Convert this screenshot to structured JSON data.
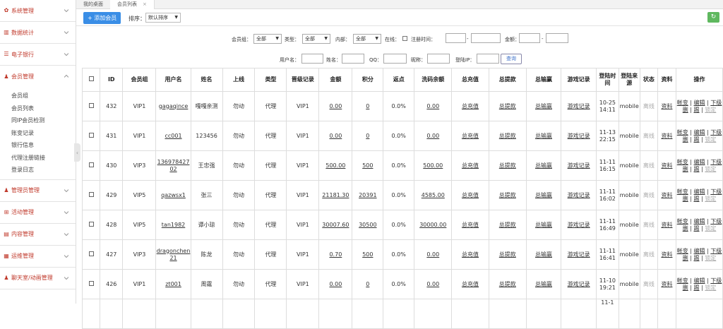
{
  "sidebar": {
    "groups": [
      {
        "label": "系统管理",
        "icon": "gear-icon"
      },
      {
        "label": "数据统计",
        "icon": "chart-icon"
      },
      {
        "label": "电子银行",
        "icon": "list-icon"
      },
      {
        "label": "会员管理",
        "icon": "user-icon"
      },
      {
        "label": "管理员管理",
        "icon": "admin-icon"
      },
      {
        "label": "活动管理",
        "icon": "gift-icon"
      },
      {
        "label": "内容管理",
        "icon": "content-icon"
      },
      {
        "label": "运维管理",
        "icon": "ops-icon"
      },
      {
        "label": "聊天室/动画管理",
        "icon": "chat-icon"
      }
    ],
    "member_sub": [
      "会员组",
      "会员列表",
      "同IP会员检测",
      "账变记录",
      "银行信息",
      "代理注册链接",
      "登录日志"
    ]
  },
  "tabs": [
    {
      "label": "我的桌面"
    },
    {
      "label": "会员列表",
      "close": "×"
    }
  ],
  "toolbar": {
    "add_label": "添加会员",
    "sort_label": "排序：",
    "sort_value": "默认排序"
  },
  "filters": {
    "group_label": "会员组：",
    "group_value": "全部",
    "type_label": "类型：",
    "type_value": "全部",
    "inner_label": "内部：",
    "inner_value": "全部",
    "online_label": "在线：",
    "reg_label": "注册时间：",
    "dash": "-",
    "amount_label": "金额：",
    "username_label": "用户名：",
    "name_label": "姓名：",
    "qq_label": "QQ：",
    "nick_label": "昵称：",
    "ip_label": "登陆IP：",
    "query_label": "查询"
  },
  "table": {
    "headers": [
      "ID",
      "会员组",
      "用户名",
      "姓名",
      "上线",
      "类型",
      "晋级记录",
      "金额",
      "积分",
      "返点",
      "洗码余额",
      "总充值",
      "总提款",
      "总输赢",
      "游戏记录",
      "登陆时间",
      "登陆来源",
      "状态",
      "资料",
      "操作"
    ],
    "rows": [
      {
        "id": "432",
        "group": "VIP1",
        "user": "gagaqince",
        "name": "嘎嘎亲测",
        "parent": "勿动",
        "type": "代理",
        "level": "VIP1",
        "amount": "0.00",
        "points": "0",
        "rebate": "0.0%",
        "wash": "0.00",
        "time": "10-25 14:11",
        "source": "mobile"
      },
      {
        "id": "431",
        "group": "VIP1",
        "user": "cc001",
        "name": "123456",
        "parent": "勿动",
        "type": "代理",
        "level": "VIP1",
        "amount": "0.00",
        "points": "0",
        "rebate": "0.0%",
        "wash": "0.00",
        "time": "11-13 22:15",
        "source": "mobile"
      },
      {
        "id": "430",
        "group": "VIP3",
        "user": "13697842702",
        "name": "王忠强",
        "parent": "勿动",
        "type": "代理",
        "level": "VIP1",
        "amount": "500.00",
        "points": "500",
        "rebate": "0.0%",
        "wash": "500.00",
        "time": "11-11 16:15",
        "source": "mobile"
      },
      {
        "id": "429",
        "group": "VIP5",
        "user": "qazwsx1",
        "name": "张三",
        "parent": "勿动",
        "type": "代理",
        "level": "VIP1",
        "amount": "21181.30",
        "points": "20391",
        "rebate": "0.0%",
        "wash": "4585.00",
        "time": "11-11 16:02",
        "source": "mobile"
      },
      {
        "id": "428",
        "group": "VIP5",
        "user": "tan1982",
        "name": "谭小琼",
        "parent": "勿动",
        "type": "代理",
        "level": "VIP1",
        "amount": "30007.60",
        "points": "30500",
        "rebate": "0.0%",
        "wash": "30000.00",
        "time": "11-11 16:49",
        "source": "mobile"
      },
      {
        "id": "427",
        "group": "VIP3",
        "user": "dragonchen21",
        "name": "陈龙",
        "parent": "勿动",
        "type": "代理",
        "level": "VIP1",
        "amount": "0.70",
        "points": "500",
        "rebate": "0.0%",
        "wash": "0.00",
        "time": "11-11 16:41",
        "source": "mobile"
      },
      {
        "id": "426",
        "group": "VIP1",
        "user": "zt001",
        "name": "周霆",
        "parent": "勿动",
        "type": "代理",
        "level": "VIP1",
        "amount": "0.00",
        "points": "0",
        "rebate": "0.0%",
        "wash": "0.00",
        "time": "11-10 19:21",
        "source": "mobile"
      }
    ],
    "partial_row_time": "11-1",
    "links": {
      "recharge": "总充值",
      "withdraw": "总提款",
      "winloss": "总输赢",
      "games": "游戏记录"
    },
    "status": "离线",
    "profile": "资料",
    "ops": {
      "change": "帐变",
      "edit": "编辑",
      "downline": "下级",
      "delete": "删",
      "kick": "踢",
      "lock": "锁定",
      "sep": "|"
    }
  }
}
